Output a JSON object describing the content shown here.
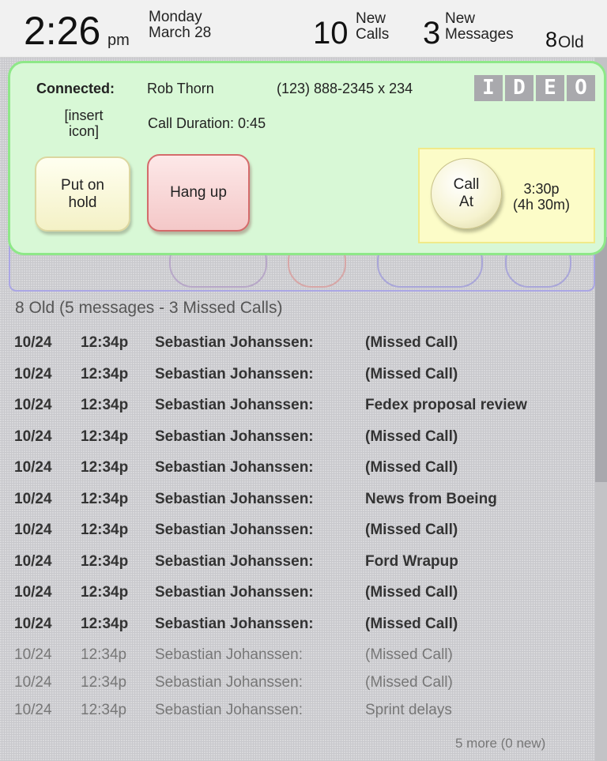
{
  "status": {
    "time": "2:26",
    "ampm": "pm",
    "day": "Monday",
    "date": "March 28",
    "new_calls_count": "10",
    "new_calls_label_1": "New",
    "new_calls_label_2": "Calls",
    "new_messages_count": "3",
    "new_messages_label_1": "New",
    "new_messages_label_2": "Messages",
    "old_count": "8",
    "old_label": "Old"
  },
  "call": {
    "connected_label": "Connected:",
    "caller_name": "Rob Thorn",
    "caller_phone": "(123) 888-2345 x 234",
    "logo_letters": [
      "I",
      "D",
      "E",
      "O"
    ],
    "icon_placeholder_1": "[insert",
    "icon_placeholder_2": "icon]",
    "duration": "Call Duration: 0:45",
    "hold_label_1": "Put on",
    "hold_label_2": "hold",
    "hangup_label": "Hang up",
    "callat_label_1": "Call",
    "callat_label_2": "At",
    "callat_time_1": "3:30p",
    "callat_time_2": "(4h 30m)"
  },
  "list": {
    "header": "8 Old (5 messages - 3 Missed Calls)",
    "rows": [
      {
        "date": "10/24",
        "time": "12:34p",
        "name": "Sebastian Johanssen:",
        "subject": "(Missed Call)"
      },
      {
        "date": "10/24",
        "time": "12:34p",
        "name": "Sebastian Johanssen:",
        "subject": "(Missed Call)"
      },
      {
        "date": "10/24",
        "time": "12:34p",
        "name": "Sebastian Johanssen:",
        "subject": "Fedex proposal review"
      },
      {
        "date": "10/24",
        "time": "12:34p",
        "name": "Sebastian Johanssen:",
        "subject": "(Missed Call)"
      },
      {
        "date": "10/24",
        "time": "12:34p",
        "name": "Sebastian Johanssen:",
        "subject": "(Missed Call)"
      },
      {
        "date": "10/24",
        "time": "12:34p",
        "name": "Sebastian Johanssen:",
        "subject": "News from Boeing"
      },
      {
        "date": "10/24",
        "time": "12:34p",
        "name": "Sebastian Johanssen:",
        "subject": "(Missed Call)"
      },
      {
        "date": "10/24",
        "time": "12:34p",
        "name": "Sebastian Johanssen:",
        "subject": "Ford Wrapup"
      },
      {
        "date": "10/24",
        "time": "12:34p",
        "name": "Sebastian Johanssen:",
        "subject": "(Missed Call)"
      },
      {
        "date": "10/24",
        "time": "12:34p",
        "name": "Sebastian Johanssen:",
        "subject": "(Missed Call)"
      },
      {
        "date": "10/24",
        "time": "12:34p",
        "name": "Sebastian Johanssen:",
        "subject": "(Missed Call)"
      },
      {
        "date": "10/24",
        "time": "12:34p",
        "name": "Sebastian Johanssen:",
        "subject": "(Missed Call)"
      },
      {
        "date": "10/24",
        "time": "12:34p",
        "name": "Sebastian Johanssen:",
        "subject": "Sprint delays"
      }
    ],
    "more": "5 more (0 new)"
  }
}
